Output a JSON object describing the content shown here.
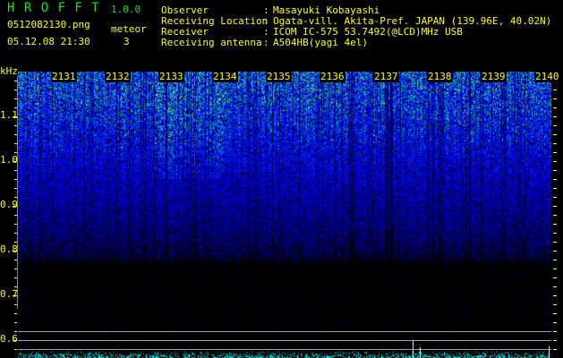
{
  "header": {
    "app_title": "H R O F F T",
    "version": "1.0.0",
    "filename": "0512082130.png",
    "datetime": "05.12.08 21:30",
    "meteor_label": "meteor",
    "meteor_count": "3"
  },
  "info": [
    {
      "label": "Observer",
      "value": "Masayuki Kobayashi"
    },
    {
      "label": "Receiving Location",
      "value": "Ogata-vill. Akita-Pref. JAPAN (139.96E, 40.02N)"
    },
    {
      "label": "Receiver",
      "value": "ICOM IC-575 53.7492(@LCD)MHz USB"
    },
    {
      "label": "Receiving antenna",
      "value": "A504HB(yagi 4el)"
    }
  ],
  "colon": ":",
  "axis": {
    "unit": "kHz",
    "y_labels": [
      "1.1",
      "1.0",
      "0.9",
      "0.8",
      "0.7",
      "0.6"
    ],
    "time_labels": [
      "2131",
      "2132",
      "2133",
      "2134",
      "2135",
      "2136",
      "2137",
      "2138",
      "2139",
      "2140"
    ]
  },
  "colors": {
    "text": "#ffff00",
    "title": "#22dd22",
    "histogram": "#00e0e0"
  }
}
